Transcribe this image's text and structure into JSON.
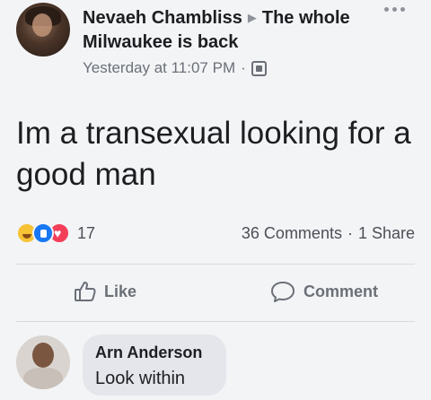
{
  "post": {
    "author": "Nevaeh Chambliss",
    "group": "The whole Milwaukee is back",
    "timestamp": "Yesterday at 11:07 PM",
    "audience_icon": "group-audience-icon",
    "text": "Im a transexual looking for a good man"
  },
  "reactions": {
    "icons": [
      "haha-reaction-icon",
      "like-reaction-icon",
      "love-reaction-icon"
    ],
    "count": "17",
    "comments": "36 Comments",
    "shares": "1 Share"
  },
  "actions": {
    "like_label": "Like",
    "comment_label": "Comment"
  },
  "comment": {
    "name": "Arn Anderson",
    "text": "Look within"
  },
  "colors": {
    "background": "#f3f4f6",
    "text": "#1c1e21",
    "muted": "#6b7078",
    "bubble": "#e4e6eb",
    "like_blue": "#1877f2",
    "love_red": "#f33e58",
    "haha_yellow": "#f7c234"
  }
}
